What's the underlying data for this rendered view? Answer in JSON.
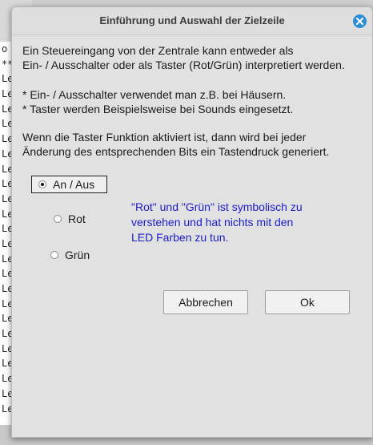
{
  "background_window": {
    "lines": [
      "o f",
      "***",
      "Ler",
      "Ler",
      "Ler",
      "Ler",
      "Ler",
      "Ler",
      "Ler",
      "Ler",
      "Ler",
      "Ler",
      "Ler",
      "Ler",
      "Ler",
      "Ler",
      "Ler",
      "Ler",
      "Ler",
      "Ler",
      "Ler",
      "Ler",
      "Ler",
      "Ler",
      "Ler"
    ]
  },
  "dialog": {
    "title": "Einführung und Auswahl der Zielzeile",
    "intro": [
      "Ein Steuereingang von der Zentrale kann entweder als",
      "Ein- / Ausschalter oder als Taster (Rot/Grün) interpretiert werden."
    ],
    "bullets": [
      "* Ein- / Ausschalter verwendet man z.B. bei Häusern.",
      "* Taster werden Beispielsweise bei Sounds eingesetzt."
    ],
    "explanation": [
      "Wenn die Taster Funktion aktiviert ist, dann wird bei jeder",
      "Änderung des entsprechenden Bits ein Tastendruck generiert."
    ],
    "options": [
      {
        "label": "An / Aus",
        "checked": true
      },
      {
        "label": "Rot",
        "checked": false
      },
      {
        "label": "Grün",
        "checked": false
      }
    ],
    "note": [
      "\"Rot\" und \"Grün\" ist symbolisch zu",
      "verstehen und hat nichts mit den",
      "LED Farben zu tun."
    ],
    "cancel_label": "Abbrechen",
    "ok_label": "Ok"
  },
  "colors": {
    "note_text": "#1d1dc8",
    "close_button": "#2d8fd6"
  },
  "icons": {
    "close": "close-icon"
  }
}
